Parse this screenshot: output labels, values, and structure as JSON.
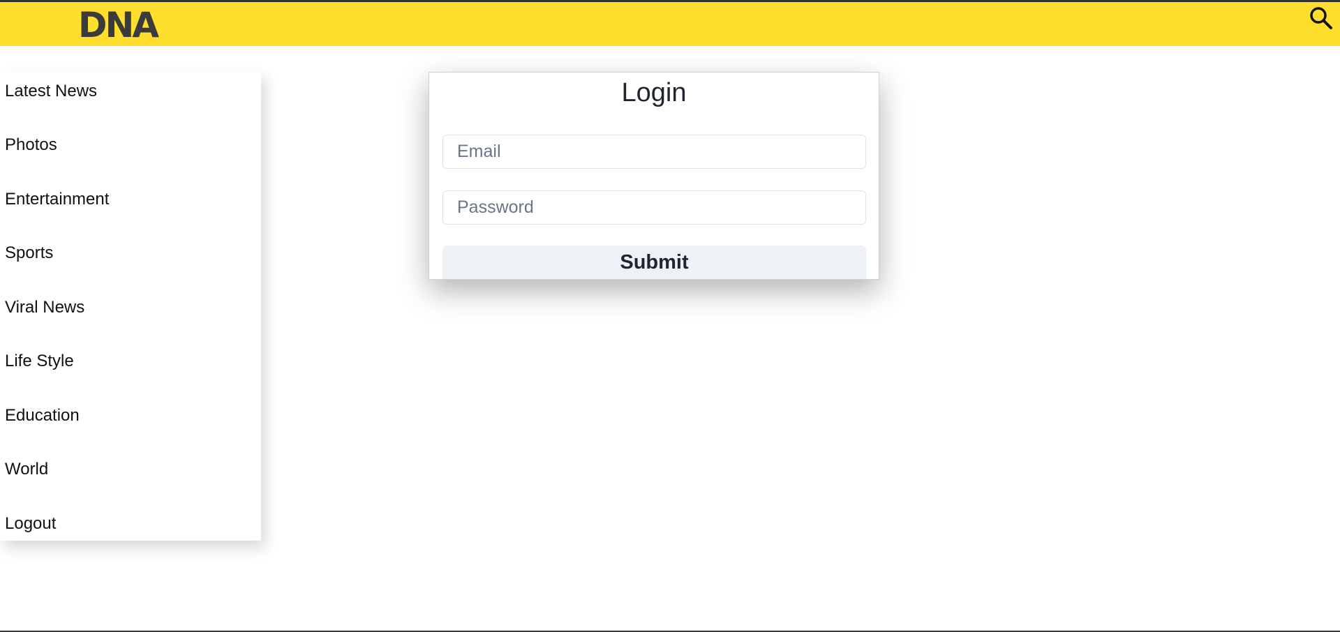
{
  "header": {
    "logo_text": "DNA",
    "brand_color": "#ffde2e",
    "search_icon": "search-icon"
  },
  "sidebar": {
    "items": [
      {
        "label": "Latest News"
      },
      {
        "label": "Photos"
      },
      {
        "label": "Entertainment"
      },
      {
        "label": "Sports"
      },
      {
        "label": "Viral News"
      },
      {
        "label": "Life Style"
      },
      {
        "label": "Education"
      },
      {
        "label": "World"
      },
      {
        "label": "Logout"
      }
    ]
  },
  "login": {
    "title": "Login",
    "email_placeholder": "Email",
    "email_value": "",
    "password_placeholder": "Password",
    "password_value": "",
    "submit_label": "Submit"
  }
}
